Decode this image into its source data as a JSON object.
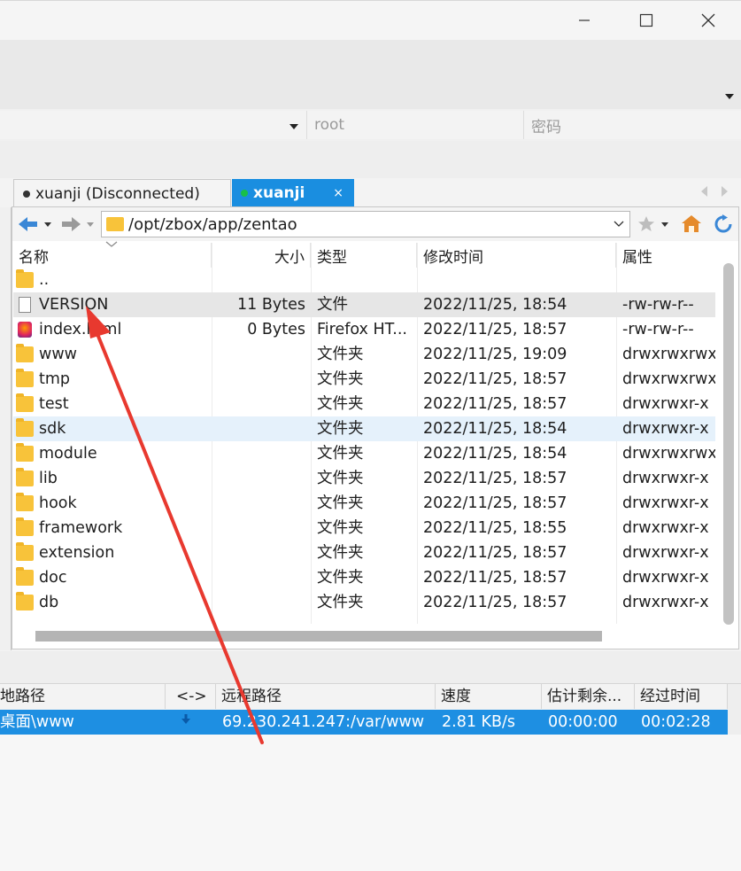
{
  "window": {
    "minimize_glyph": "—",
    "maximize_glyph": "☐",
    "close_glyph": "✕"
  },
  "quickconnect": {
    "user": "root",
    "password_placeholder": "密码"
  },
  "tabs": [
    {
      "label": "xuanji (Disconnected)",
      "status_color": "#333333"
    },
    {
      "label": "xuanji",
      "status_color": "#18c04a",
      "close": "×"
    }
  ],
  "path": "/opt/zbox/app/zentao",
  "columns": {
    "name": "名称",
    "size": "大小",
    "type": "类型",
    "mtime": "修改时间",
    "attr": "属性"
  },
  "files": [
    {
      "name": "..",
      "size": "",
      "type": "",
      "mtime": "",
      "attr": "",
      "icon": "folder-icon"
    },
    {
      "name": "VERSION",
      "size": "11 Bytes",
      "type": "文件",
      "mtime": "2022/11/25, 18:54",
      "attr": "-rw-rw-r--",
      "icon": "file-icon"
    },
    {
      "name": "index.html",
      "size": "0 Bytes",
      "type": "Firefox HT...",
      "mtime": "2022/11/25, 18:57",
      "attr": "-rw-rw-r--",
      "icon": "firefox-icon"
    },
    {
      "name": "www",
      "size": "",
      "type": "文件夹",
      "mtime": "2022/11/25, 19:09",
      "attr": "drwxrwxrwx",
      "icon": "folder-icon"
    },
    {
      "name": "tmp",
      "size": "",
      "type": "文件夹",
      "mtime": "2022/11/25, 18:57",
      "attr": "drwxrwxrwx",
      "icon": "folder-icon"
    },
    {
      "name": "test",
      "size": "",
      "type": "文件夹",
      "mtime": "2022/11/25, 18:57",
      "attr": "drwxrwxr-x",
      "icon": "folder-icon"
    },
    {
      "name": "sdk",
      "size": "",
      "type": "文件夹",
      "mtime": "2022/11/25, 18:54",
      "attr": "drwxrwxr-x",
      "icon": "folder-icon"
    },
    {
      "name": "module",
      "size": "",
      "type": "文件夹",
      "mtime": "2022/11/25, 18:54",
      "attr": "drwxrwxrwx",
      "icon": "folder-icon"
    },
    {
      "name": "lib",
      "size": "",
      "type": "文件夹",
      "mtime": "2022/11/25, 18:57",
      "attr": "drwxrwxr-x",
      "icon": "folder-icon"
    },
    {
      "name": "hook",
      "size": "",
      "type": "文件夹",
      "mtime": "2022/11/25, 18:57",
      "attr": "drwxrwxr-x",
      "icon": "folder-icon"
    },
    {
      "name": "framework",
      "size": "",
      "type": "文件夹",
      "mtime": "2022/11/25, 18:55",
      "attr": "drwxrwxr-x",
      "icon": "folder-icon"
    },
    {
      "name": "extension",
      "size": "",
      "type": "文件夹",
      "mtime": "2022/11/25, 18:57",
      "attr": "drwxrwxr-x",
      "icon": "folder-icon"
    },
    {
      "name": "doc",
      "size": "",
      "type": "文件夹",
      "mtime": "2022/11/25, 18:57",
      "attr": "drwxrwxr-x",
      "icon": "folder-icon"
    },
    {
      "name": "db",
      "size": "",
      "type": "文件夹",
      "mtime": "2022/11/25, 18:57",
      "attr": "drwxrwxr-x",
      "icon": "folder-icon"
    }
  ],
  "queue": {
    "columns": {
      "local": "地路径",
      "dir": "<->",
      "remote": "远程路径",
      "speed": "速度",
      "remaining": "估计剩余...",
      "elapsed": "经过时间"
    },
    "row": {
      "local": "桌面\\www",
      "remote": "69.230.241.247:/var/www",
      "speed": "2.81 KB/s",
      "remaining": "00:00:00",
      "elapsed": "00:02:28"
    }
  },
  "colors": {
    "accent": "#1a8ee0",
    "selected_row": "#e6e6e6",
    "hover_row": "#e5f1fb",
    "annotation": "#e8392f"
  }
}
